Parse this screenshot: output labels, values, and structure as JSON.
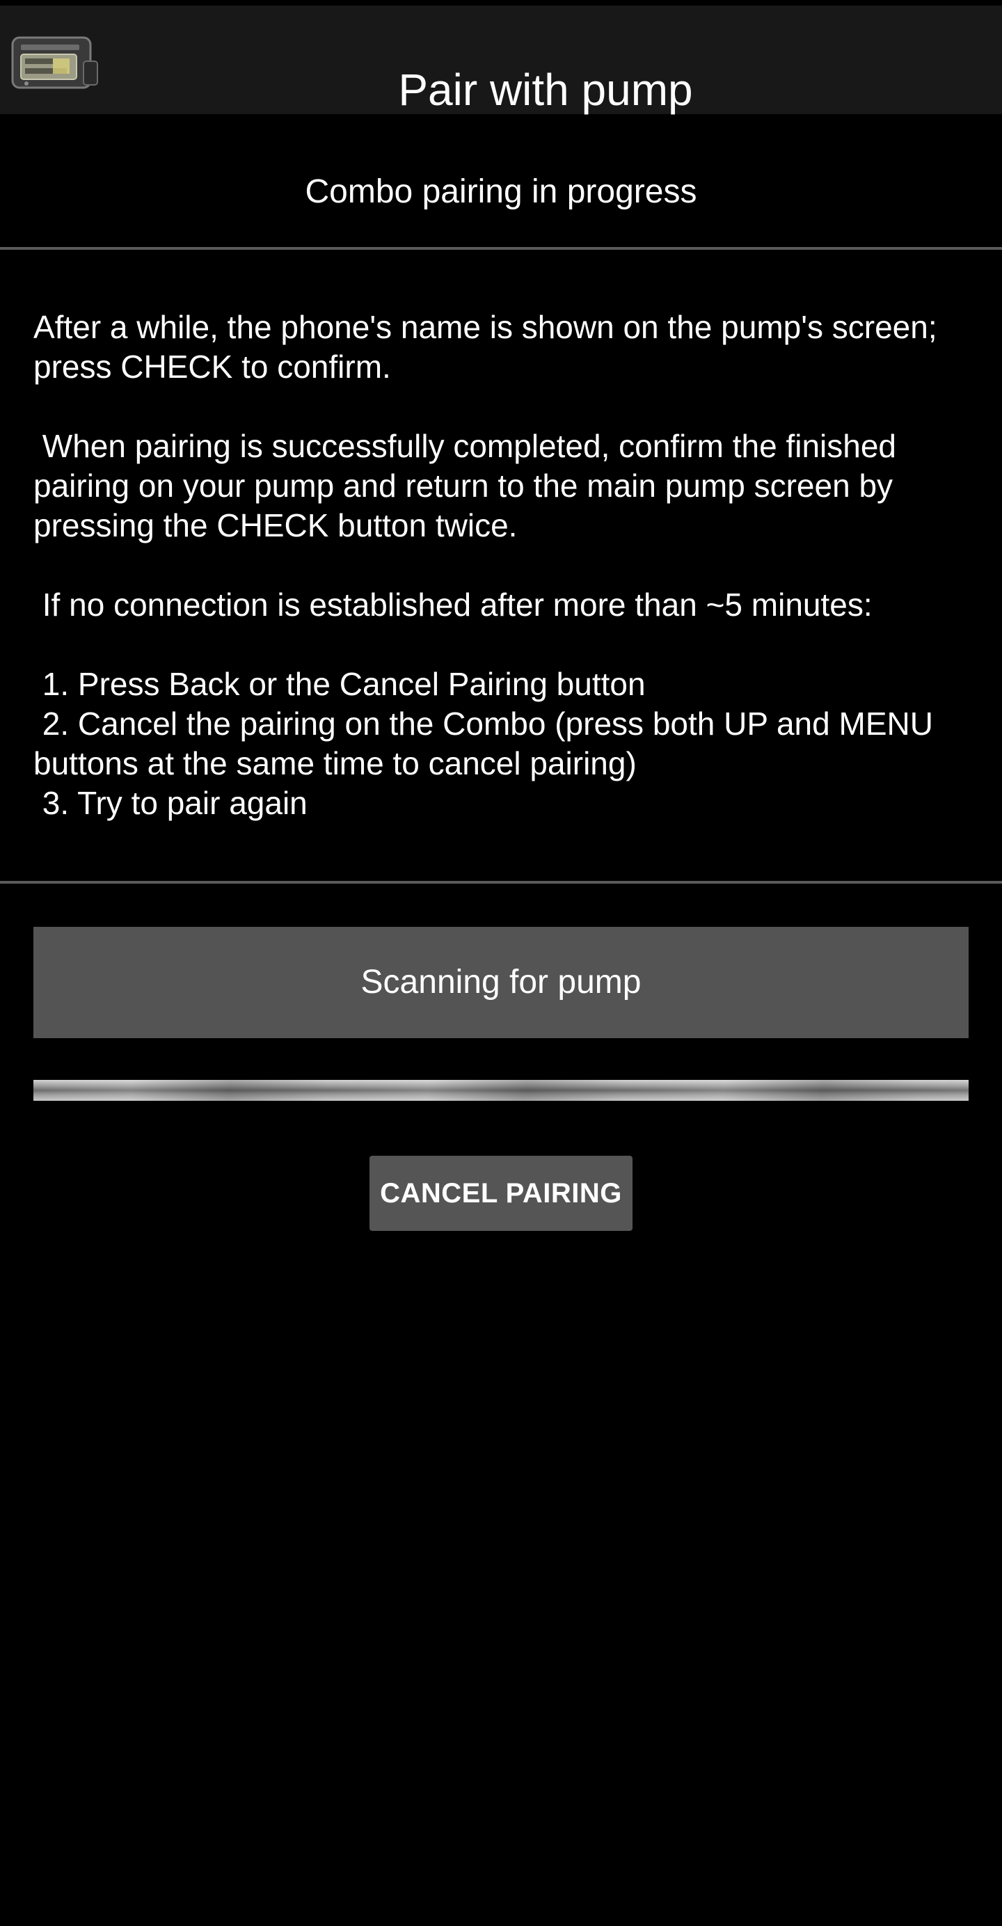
{
  "app_bar": {
    "title": "Pair with pump",
    "icon": "insulin-pump-icon"
  },
  "pairing_status": "Combo pairing in progress",
  "instructions": {
    "paragraphs": [
      "After a while, the phone's name is shown on the pump's screen; press CHECK to confirm.",
      " When pairing is successfully completed, confirm the finished pairing on your pump and return to the main pump screen by pressing the CHECK button twice.",
      " If no connection is established after more than ~5 minutes:"
    ],
    "steps": [
      " 1. Press Back or the Cancel Pairing button",
      " 2. Cancel the pairing on the Combo (press both UP and MENU buttons at the same time to cancel pairing)",
      " 3. Try to pair again"
    ]
  },
  "scan_status": "Scanning for pump",
  "progress": {
    "indeterminate": true
  },
  "cancel_button_label": "CANCEL PAIRING",
  "colors": {
    "background": "#000000",
    "app_bar": "#181818",
    "divider": "#5a5a5a",
    "status_box": "#545454",
    "button": "#555555",
    "text": "#ffffff"
  }
}
